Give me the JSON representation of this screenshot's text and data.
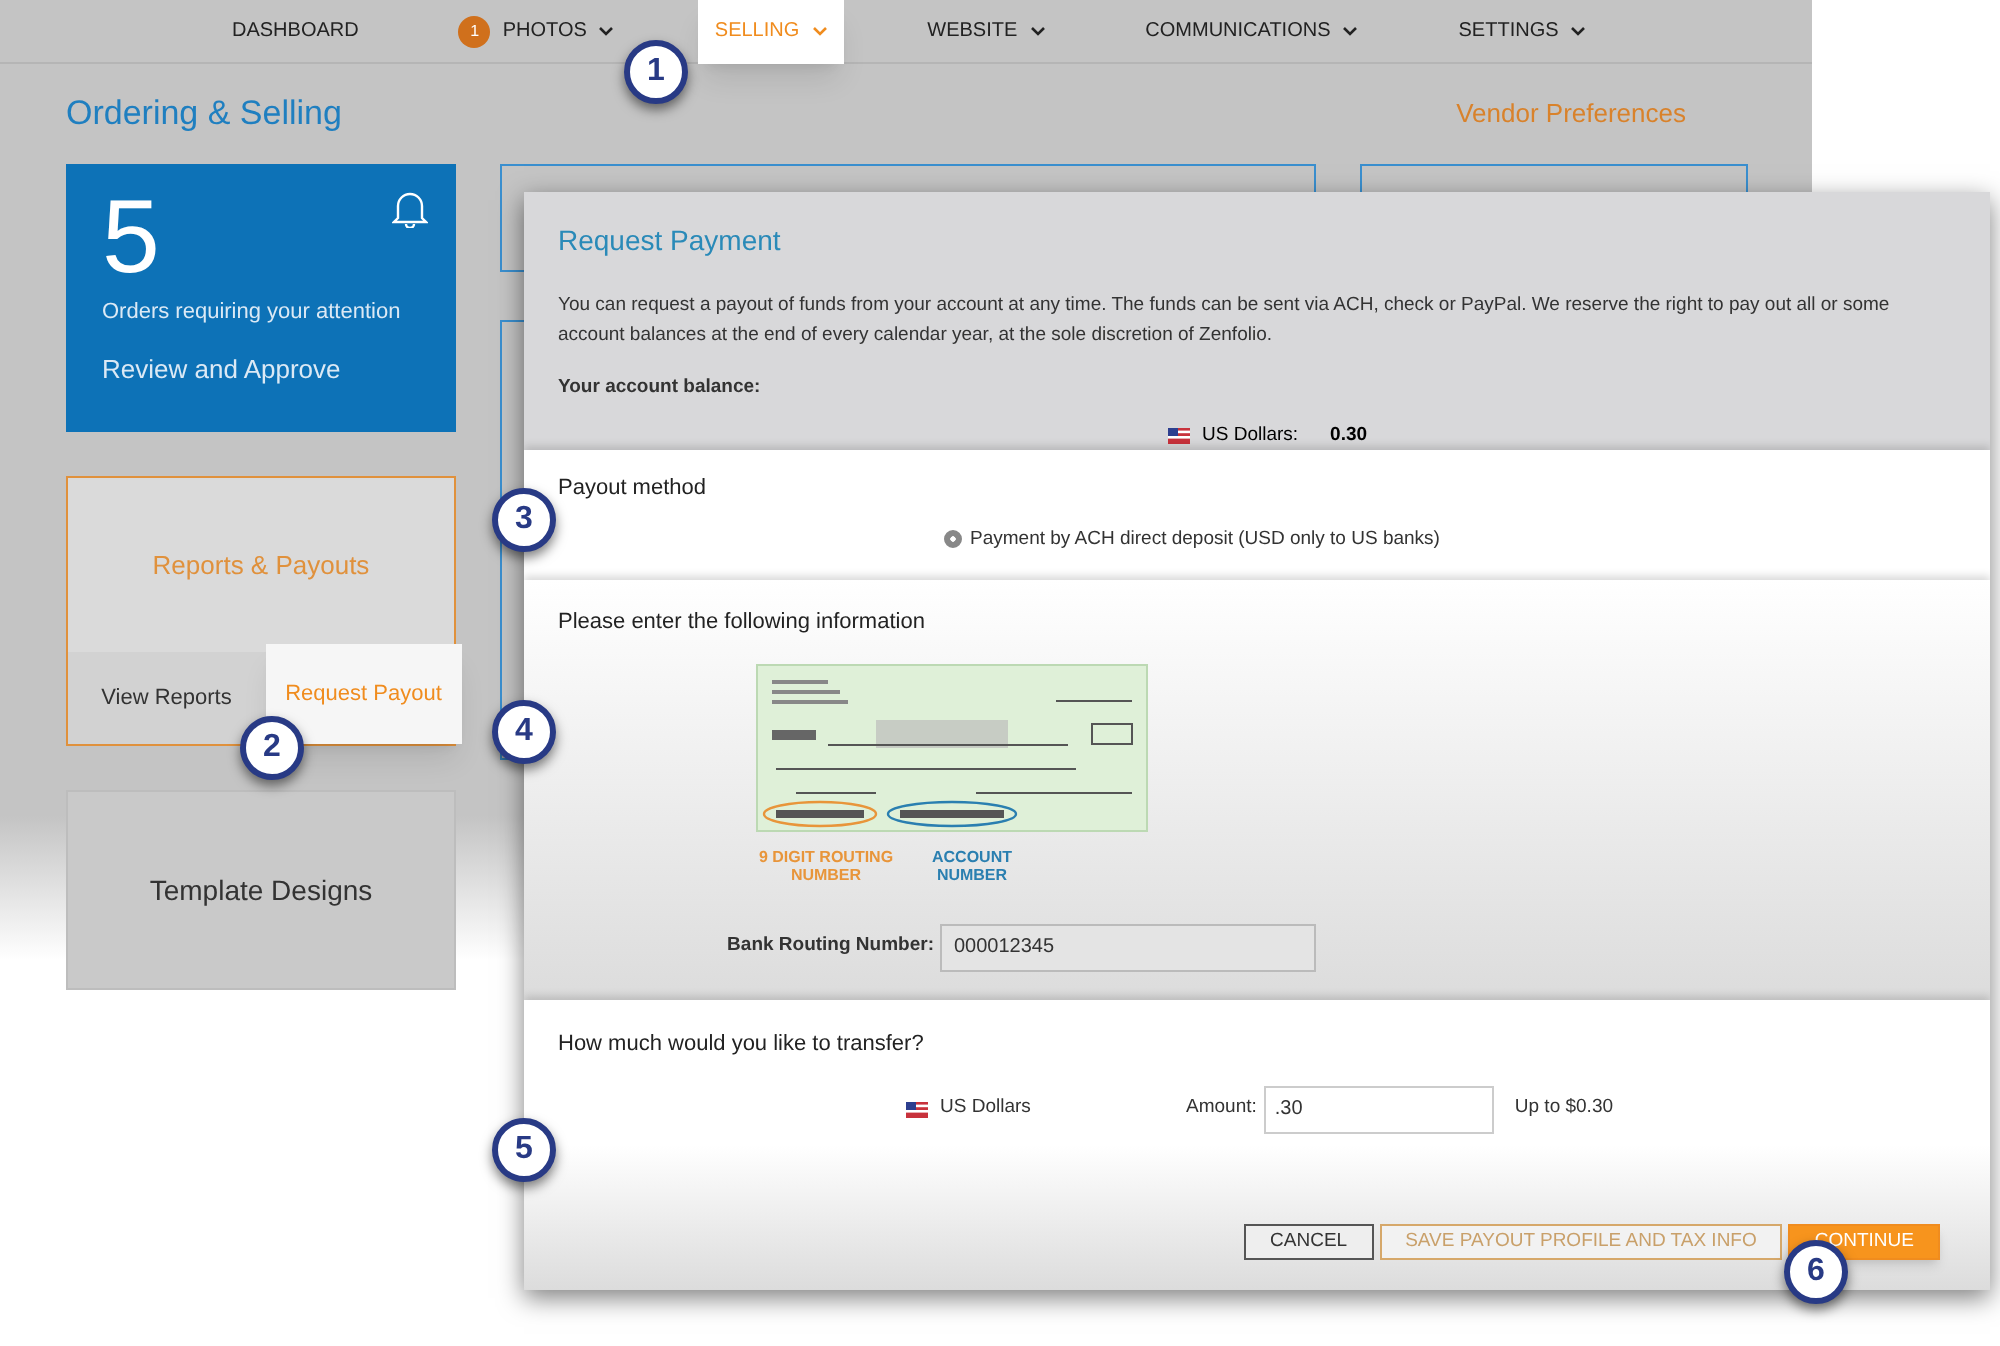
{
  "nav": [
    {
      "label": "DASHBOARD",
      "selected": false,
      "caret": false
    },
    {
      "label": "PHOTOS",
      "selected": false,
      "caret": true,
      "badge": "1"
    },
    {
      "label": "SELLING",
      "selected": true,
      "caret": true
    },
    {
      "label": "WEBSITE",
      "selected": false,
      "caret": true
    },
    {
      "label": "COMMUNICATIONS",
      "selected": false,
      "caret": true
    },
    {
      "label": "SETTINGS",
      "selected": false,
      "caret": true
    }
  ],
  "page": {
    "title": "Ordering & Selling",
    "link": "Vendor Preferences"
  },
  "orders_card": {
    "count": "5",
    "caption": "Orders requiring your attention",
    "action": "Review and Approve"
  },
  "reports_card": {
    "title": "Reports & Payouts",
    "actions": [
      {
        "label": "View Reports",
        "selected": false
      },
      {
        "label": "Request Payout",
        "selected": true
      }
    ]
  },
  "template_card": {
    "title": "Template Designs"
  },
  "dialog": {
    "title": "Request Payment",
    "intro": "You can request a payout of funds from your account at any time. The funds can be sent via ACH, check or PayPal. We reserve the right to pay out all or some account balances at the end of every calendar year, at the sole discretion of Zenfolio.",
    "balance_label": "Your account balance:",
    "balance_currency": "US Dollars:",
    "balance_value": "0.30",
    "payout_heading": "Payout method",
    "payout_options": [
      {
        "label": "Payment by ACH direct deposit (USD only to US banks)",
        "selected": true
      }
    ],
    "info_heading": "Please enter the following information",
    "check_labels": [
      {
        "text": "9 DIGIT ROUTING NUMBER",
        "color": "#e8953a"
      },
      {
        "text": "ACCOUNT NUMBER",
        "color": "#2a7fb0"
      }
    ],
    "fields": [
      {
        "label": "Bank Routing Number:",
        "value": "000012345"
      }
    ],
    "transfer_heading": "How much would you like to transfer?",
    "currency": "US Dollars",
    "amount_label": "Amount:",
    "amount_value": ".30",
    "limit": "Up to $0.30",
    "buttons": [
      {
        "label": "CANCEL",
        "kind": "plain"
      },
      {
        "label": "SAVE PAYOUT PROFILE AND TAX INFO",
        "kind": "outline"
      },
      {
        "label": "CONTINUE",
        "kind": "primary"
      }
    ]
  },
  "callouts": [
    "1",
    "2",
    "3",
    "4",
    "5",
    "6"
  ]
}
